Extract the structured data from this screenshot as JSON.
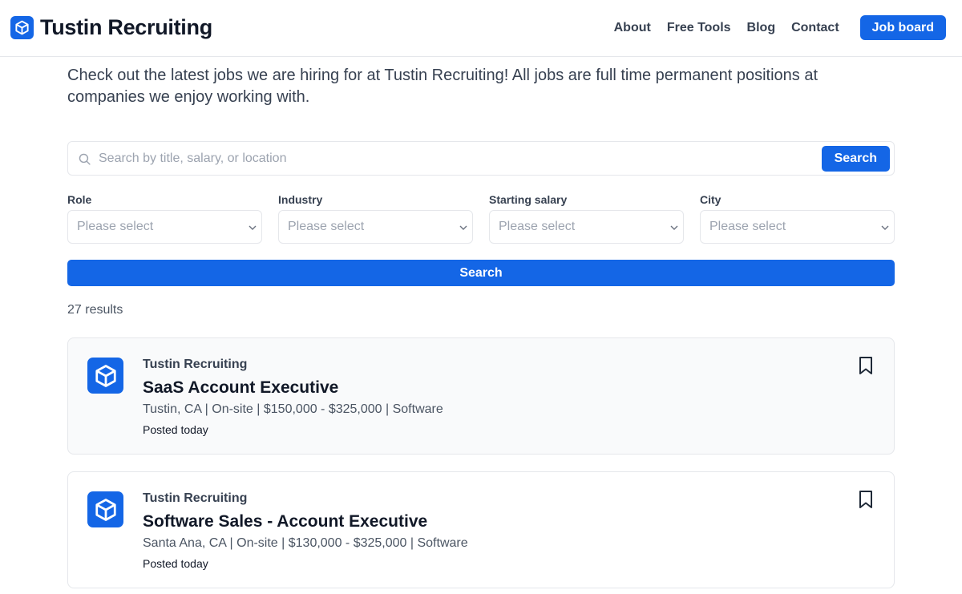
{
  "header": {
    "brand_name": "Tustin Recruiting",
    "nav": [
      "About",
      "Free Tools",
      "Blog",
      "Contact"
    ],
    "cta": "Job board"
  },
  "intro": "Check out the latest jobs we are hiring for at Tustin Recruiting! All jobs are full time permanent positions at companies we enjoy working with.",
  "search": {
    "placeholder": "Search by title, salary, or location",
    "button": "Search"
  },
  "filters": [
    {
      "label": "Role",
      "value": "Please select"
    },
    {
      "label": "Industry",
      "value": "Please select"
    },
    {
      "label": "Starting salary",
      "value": "Please select"
    },
    {
      "label": "City",
      "value": "Please select"
    }
  ],
  "search_all_button": "Search",
  "results_count": "27 results",
  "jobs": [
    {
      "company": "Tustin Recruiting",
      "title": "SaaS Account Executive",
      "meta": "Tustin, CA  |  On-site | $150,000 - $325,000 | Software",
      "posted": "Posted today"
    },
    {
      "company": "Tustin Recruiting",
      "title": "Software Sales - Account Executive",
      "meta": "Santa Ana, CA  |  On-site | $130,000 - $325,000 | Software",
      "posted": "Posted today"
    }
  ],
  "colors": {
    "accent": "#1466e6",
    "border": "#e5e7eb",
    "placeholder": "#9ca3af"
  },
  "icons": {
    "brand": "cube-icon",
    "search": "search-icon",
    "select": "chevron-down-icon",
    "bookmark": "bookmark-icon"
  }
}
